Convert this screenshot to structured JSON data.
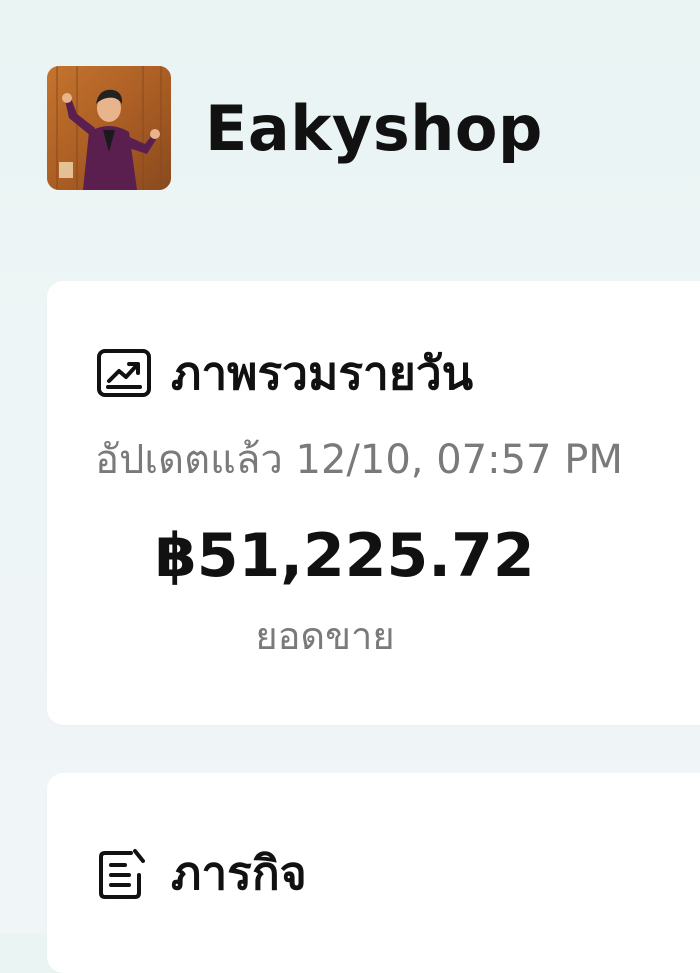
{
  "shop": {
    "name": "Eakyshop",
    "avatar_icon": "profile-photo"
  },
  "overview": {
    "icon": "trend-chart-icon",
    "title": "ภาพรวมรายวัน",
    "updated": "อัปเดตแล้ว 12/10, 07:57 PM",
    "sales_amount": "฿51,225.72",
    "sales_label": "ยอดขาย"
  },
  "tasks": {
    "icon": "checklist-icon",
    "title": "ภารกิจ"
  },
  "colors": {
    "background": "#eaf4f3",
    "card": "#ffffff",
    "text_primary": "#111111",
    "text_secondary": "#7a7a7a"
  }
}
